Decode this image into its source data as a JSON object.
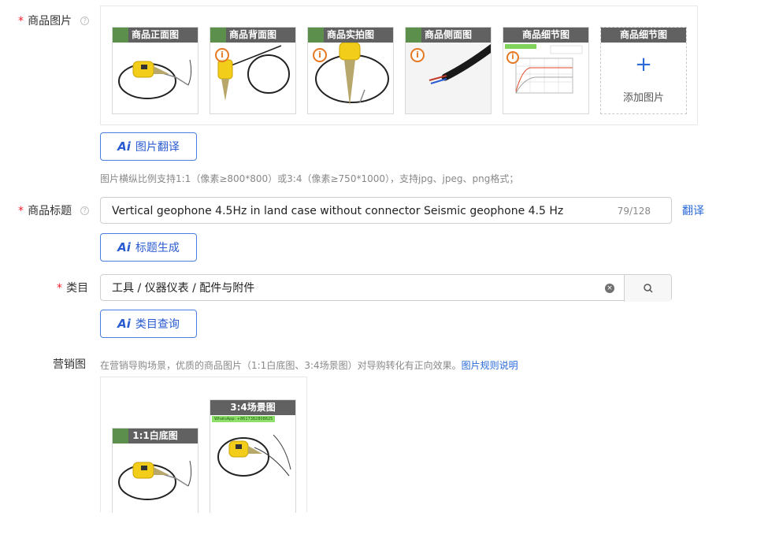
{
  "product_images": {
    "label": "商品图片",
    "required_mark": "*",
    "help_glyph": "?",
    "cards": [
      {
        "title": "商品正面图"
      },
      {
        "title": "商品背面图",
        "badge": "i"
      },
      {
        "title": "商品实拍图",
        "badge": "i"
      },
      {
        "title": "商品侧面图",
        "badge": "i"
      },
      {
        "title": "商品细节图",
        "badge": "i"
      }
    ],
    "add_card": {
      "title": "商品细节图",
      "plus": "+",
      "label": "添加图片"
    },
    "ai_button": {
      "mark": "Ai",
      "label": "图片翻译"
    },
    "hint": "图片横纵比例支持1:1（像素≥800*800）或3:4（像素≥750*1000），支持jpg、jpeg、png格式；"
  },
  "product_title": {
    "label": "商品标题",
    "required_mark": "*",
    "help_glyph": "?",
    "value": "Vertical geophone 4.5Hz in land case without connector Seismic geophone  4.5 Hz",
    "count": "79/128",
    "translate_link": "翻译",
    "ai_button": {
      "mark": "Ai",
      "label": "标题生成"
    }
  },
  "category": {
    "label": "类目",
    "required_mark": "*",
    "value": "工具 / 仪器仪表 / 配件与附件",
    "clear_glyph": "×",
    "ai_button": {
      "mark": "Ai",
      "label": "类目查询"
    }
  },
  "marketing": {
    "label": "营销图",
    "hint": "在营销导购场景，优质的商品图片（1:1白底图、3:4场景图）对导购转化有正向效果。",
    "rule_link": "图片规则说明",
    "cards": [
      {
        "title": "1:1白底图"
      },
      {
        "title": "3:4场景图",
        "watermark": "WhatsApp: +8617382808825"
      }
    ]
  },
  "colors": {
    "accent": "#2a6ad9",
    "required": "#f5222d",
    "badge": "#e6781f",
    "header_bg": "#616161"
  }
}
